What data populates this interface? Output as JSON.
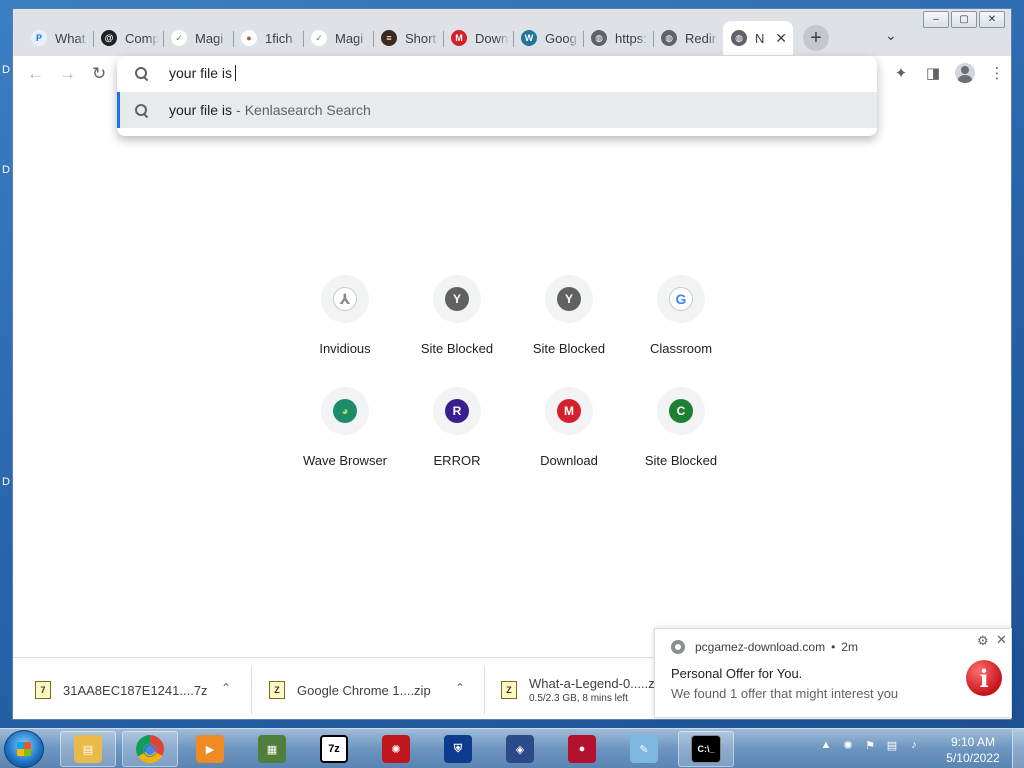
{
  "window": {
    "controls": {
      "minimize": "–",
      "restore": "▢",
      "close": "✕"
    }
  },
  "tabs": [
    {
      "label": "What",
      "favicon_color": "#e8f0fe",
      "favicon_text": "P",
      "favicon_text_color": "#1a73e8"
    },
    {
      "label": "Comp",
      "favicon_color": "#202124",
      "favicon_text": "@",
      "favicon_text_color": "#ffffff"
    },
    {
      "label": "Magi",
      "favicon_color": "#ffffff",
      "favicon_text": "✓",
      "favicon_text_color": "#2e9e5b"
    },
    {
      "label": "1fich",
      "favicon_color": "#ffffff",
      "favicon_text": "●",
      "favicon_text_color": "#c0562a"
    },
    {
      "label": "Magi",
      "favicon_color": "#ffffff",
      "favicon_text": "✓",
      "favicon_text_color": "#2e9e5b"
    },
    {
      "label": "Short",
      "favicon_color": "#3d2a1e",
      "favicon_text": "≡",
      "favicon_text_color": "#ffffff"
    },
    {
      "label": "Down",
      "favicon_color": "#d3202b",
      "favicon_text": "M",
      "favicon_text_color": "#ffffff"
    },
    {
      "label": "Goog",
      "favicon_color": "#21759b",
      "favicon_text": "W",
      "favicon_text_color": "#ffffff"
    },
    {
      "label": "https:",
      "favicon_color": "#5f6368",
      "favicon_text": "◍",
      "favicon_text_color": "#ffffff"
    },
    {
      "label": "Redir",
      "favicon_color": "#5f6368",
      "favicon_text": "◍",
      "favicon_text_color": "#ffffff"
    },
    {
      "label": "N",
      "favicon_color": "#5f6368",
      "favicon_text": "◍",
      "favicon_text_color": "#ffffff",
      "active": true,
      "close": "✕"
    }
  ],
  "new_tab_glyph": "+",
  "tab_search_glyph": "⌄",
  "toolbar": {
    "back": "←",
    "forward": "→",
    "reload": "↻",
    "extensions": "✦",
    "sidepanel": "◨",
    "menu": "⋮"
  },
  "omnibox": {
    "input_text": "your file is",
    "suggestion": {
      "query": "your file is",
      "separator": "-",
      "engine": "Kenlasearch Search"
    }
  },
  "shortcuts": [
    {
      "label": "Invidious",
      "glyph": "⅄",
      "bg": "#ffffff",
      "fg": "#888888"
    },
    {
      "label": "Site Blocked",
      "glyph": "Y",
      "bg": "#616161",
      "fg": "#ffffff"
    },
    {
      "label": "Site Blocked",
      "glyph": "Y",
      "bg": "#616161",
      "fg": "#ffffff"
    },
    {
      "label": "Classroom",
      "glyph": "G",
      "bg": "#ffffff",
      "fg": "#4285f4"
    },
    {
      "label": "Wave Browser",
      "glyph": "◕",
      "bg": "#1e8c6a",
      "fg": "#9be15d"
    },
    {
      "label": "ERROR",
      "glyph": "R",
      "bg": "#3b1f8f",
      "fg": "#ffffff"
    },
    {
      "label": "Download",
      "glyph": "M",
      "bg": "#d3202b",
      "fg": "#ffffff"
    },
    {
      "label": "Site Blocked",
      "glyph": "C",
      "bg": "#1e7e34",
      "fg": "#ffffff"
    }
  ],
  "downloads": [
    {
      "name": "31AA8EC187E1241....7z",
      "icon": "7",
      "chevron": "⌃"
    },
    {
      "name": "Google Chrome 1....zip",
      "icon": "Z",
      "chevron": "⌃"
    },
    {
      "name": "What-a-Legend-0.....zip",
      "icon": "Z",
      "status": "0.5/2.3 GB, 8 mins left"
    }
  ],
  "notification": {
    "site": "pcgamez-download.com",
    "dot": "•",
    "age": "2m",
    "title": "Personal Offer for You.",
    "body": "We found 1 offer that might interest you",
    "gear": "⚙",
    "close": "✕",
    "info_glyph": "i"
  },
  "taskbar": {
    "apps": [
      {
        "name": "explorer",
        "glyph": "▤",
        "bg": "#e9b949",
        "open": true
      },
      {
        "name": "chrome",
        "glyph": "◉",
        "bg": "#db4437",
        "open": true
      },
      {
        "name": "media-player",
        "glyph": "▶",
        "bg": "#f08a24",
        "open": false
      },
      {
        "name": "task-manager",
        "glyph": "▦",
        "bg": "#4f7f3b",
        "open": false
      },
      {
        "name": "7zip",
        "glyph": "7z",
        "bg": "#111111",
        "open": false
      },
      {
        "name": "red-app",
        "glyph": "✺",
        "bg": "#c0161c",
        "open": false
      },
      {
        "name": "shield-vpn",
        "glyph": "⛨",
        "bg": "#0d3b8e",
        "open": false
      },
      {
        "name": "image-tool",
        "glyph": "◈",
        "bg": "#2c4a8a",
        "open": false
      },
      {
        "name": "screen-recorder",
        "glyph": "●",
        "bg": "#b3122e",
        "open": false
      },
      {
        "name": "notepad",
        "glyph": "✎",
        "bg": "#7fb7e0",
        "open": false
      },
      {
        "name": "cmd",
        "glyph": "C:\\_",
        "bg": "#000000",
        "open": true
      }
    ],
    "tray": {
      "arrow": "▲",
      "icons": [
        "✺",
        "⚑",
        "▤",
        "♪"
      ]
    },
    "time": "9:10 AM",
    "date": "5/10/2022"
  },
  "desktop": {
    "edge_letters": [
      "D",
      "D",
      "D"
    ]
  }
}
